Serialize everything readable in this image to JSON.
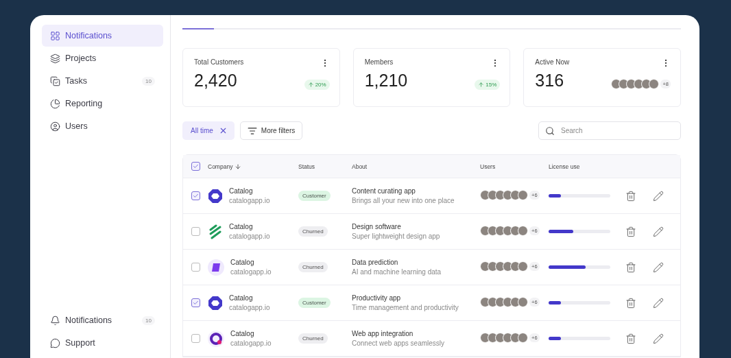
{
  "sidebar": {
    "items": [
      {
        "label": "Notifications",
        "selected": true
      },
      {
        "label": "Projects",
        "selected": false
      },
      {
        "label": "Tasks",
        "selected": false,
        "count": "10"
      },
      {
        "label": "Reporting",
        "selected": false
      },
      {
        "label": "Users",
        "selected": false
      }
    ],
    "footer_items": [
      {
        "label": "Notifications",
        "count": "10"
      },
      {
        "label": "Support"
      }
    ]
  },
  "stats": [
    {
      "title": "Total Customers",
      "value": "2,420",
      "kind": "change",
      "change": "20%"
    },
    {
      "title": "Members",
      "value": "1,210",
      "kind": "change",
      "change": "15%"
    },
    {
      "title": "Active Now",
      "value": "316",
      "kind": "avatars",
      "more": "+8"
    }
  ],
  "filters": {
    "active": "All time",
    "more": "More filters",
    "search": {
      "placeholder": "Search"
    }
  },
  "table": {
    "all_checked": true,
    "columns": [
      "Company",
      "Status",
      "About",
      "Users",
      "License use"
    ],
    "rows": [
      {
        "checked": true,
        "kind": "hexagon",
        "name": "Catalog",
        "domain": "catalogapp.io",
        "status": "Customer",
        "color": "#dcf5e3",
        "about": "Content curating app",
        "detail": "Brings all your new into one place",
        "more": "+6",
        "level": 0.2
      },
      {
        "checked": false,
        "kind": "stripes",
        "name": "Catalog",
        "domain": "catalogapp.io",
        "status": "Churned",
        "color": "#eeeef1",
        "about": "Design software",
        "detail": "Super lightweight design app",
        "more": "+6",
        "level": 0.4
      },
      {
        "checked": false,
        "kind": "cube",
        "name": "Catalog",
        "domain": "catalogapp.io",
        "status": "Churned",
        "color": "#eeeef1",
        "about": "Data prediction",
        "detail": "AI and machine learning data",
        "more": "+6",
        "level": 0.6
      },
      {
        "checked": true,
        "kind": "hexagon",
        "name": "Catalog",
        "domain": "catalogapp.io",
        "status": "Customer",
        "color": "#dcf5e3",
        "about": "Productivity app",
        "detail": "Time management and productivity",
        "more": "+6",
        "level": 0.2
      },
      {
        "checked": false,
        "kind": "ring",
        "name": "Catalog",
        "domain": "catalogapp.io",
        "status": "Churned",
        "color": "#eeeef1",
        "about": "Web app integration",
        "detail": "Connect web apps seamlessly",
        "more": "+6",
        "level": 0.2
      }
    ]
  }
}
